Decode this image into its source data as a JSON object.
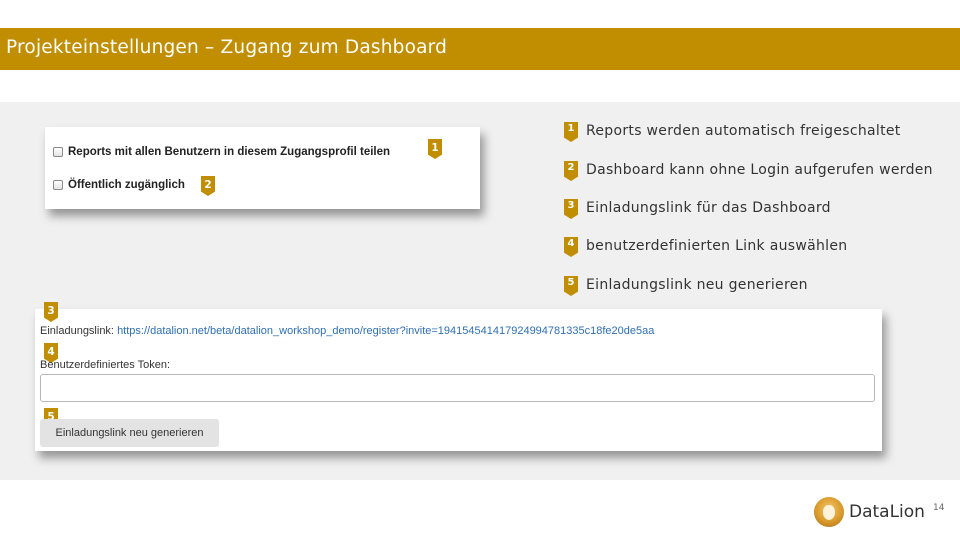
{
  "slide": {
    "title": "Projekteinstellungen – Zugang zum Dashboard",
    "page_number": "14",
    "brand_color": "#c08e00"
  },
  "top_panel": {
    "checkbox_share_label": "Reports mit allen Benutzern in diesem Zugangsprofil teilen",
    "checkbox_public_label": "Öffentlich zugänglich",
    "badge_share": "1",
    "badge_public": "2"
  },
  "bottom_panel": {
    "invite_label": "Einladungslink:",
    "invite_url": "https://datalion.net/beta/datalion_workshop_demo/register?invite=194154541417924994781335c18fe20de5aa",
    "token_label": "Benutzerdefiniertes Token:",
    "token_value": "",
    "regenerate_button": "Einladungslink neu generieren",
    "badge_invite": "3",
    "badge_token": "4",
    "badge_button": "5"
  },
  "legend": [
    {
      "number": "1",
      "text": "Reports werden automatisch freigeschaltet"
    },
    {
      "number": "2",
      "text": "Dashboard kann ohne Login aufgerufen werden"
    },
    {
      "number": "3",
      "text": "Einladungslink  für das Dashboard"
    },
    {
      "number": "4",
      "text": "benutzerdefinierten Link auswählen"
    },
    {
      "number": "5",
      "text": "Einladungslink  neu generieren"
    }
  ],
  "logo": {
    "text": "DataLion",
    "icon": "lion-logo-icon"
  }
}
